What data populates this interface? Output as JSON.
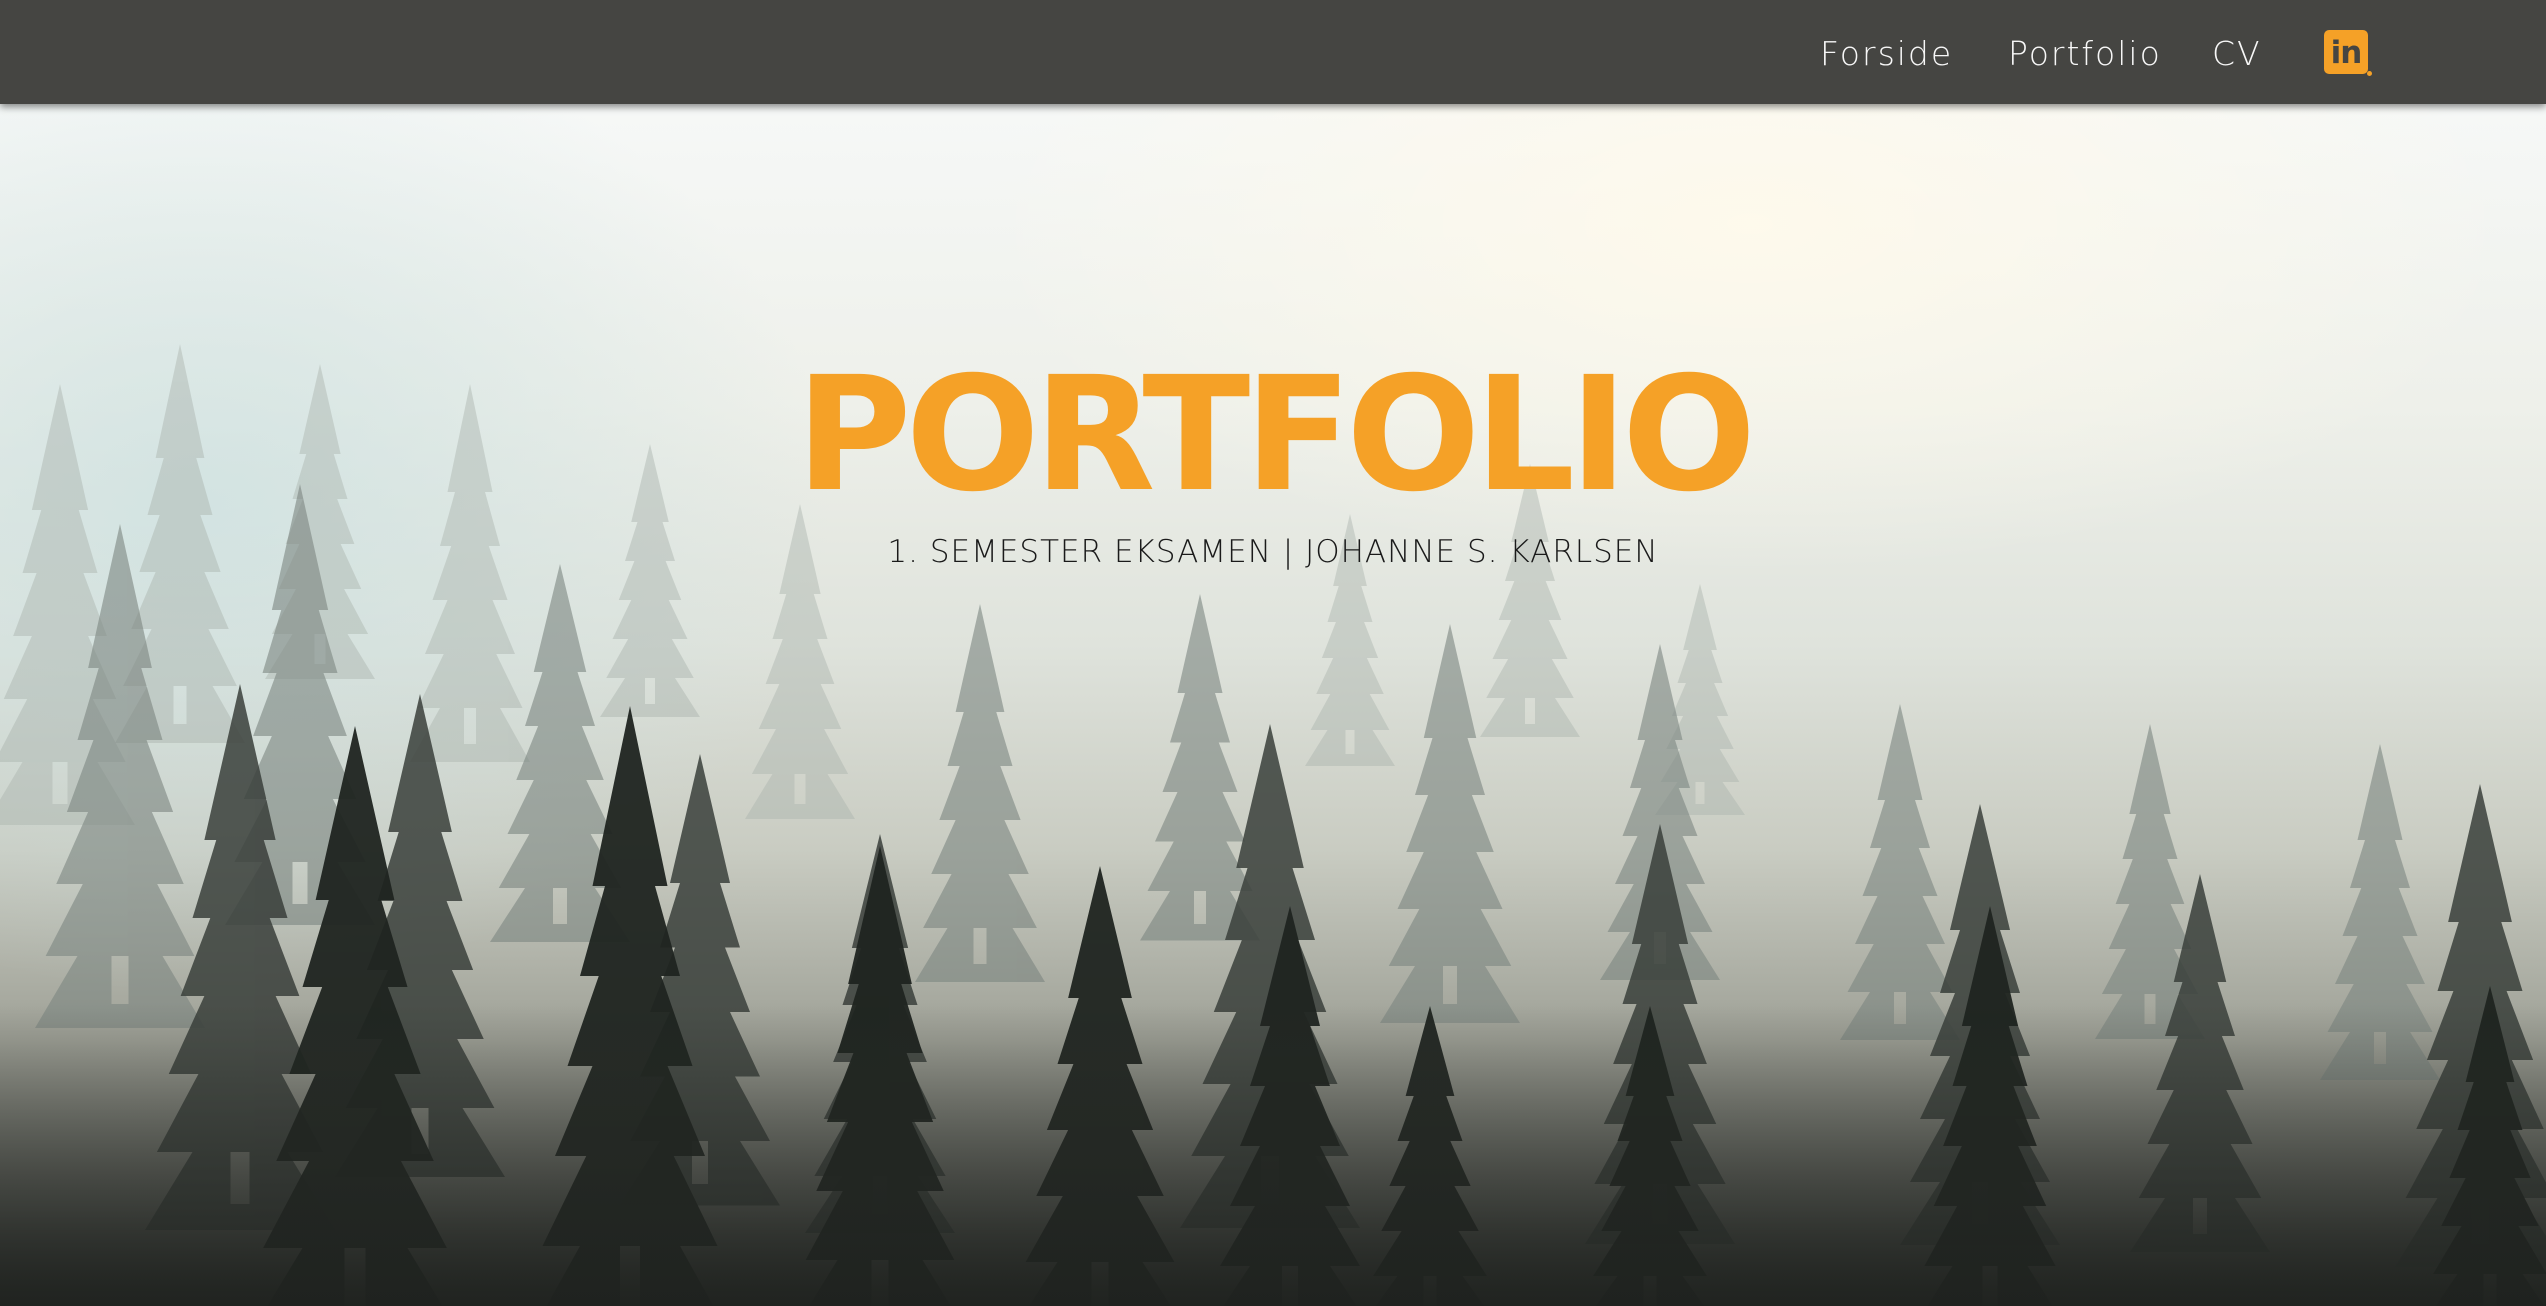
{
  "nav": {
    "items": [
      {
        "label": "Forside"
      },
      {
        "label": "Portfolio"
      },
      {
        "label": "CV"
      }
    ],
    "linkedin_icon": "linkedin-icon",
    "linkedin_text": "in"
  },
  "hero": {
    "title": "PORTFOLIO",
    "subtitle": "1. SEMESTER EKSAMEN | JOHANNE S. KARLSEN",
    "background": "misty-forest-photo"
  },
  "colors": {
    "accent": "#f5a127",
    "navbar": "#454542",
    "nav_text": "#ffffff",
    "subtitle_text": "#1a1a1a"
  }
}
